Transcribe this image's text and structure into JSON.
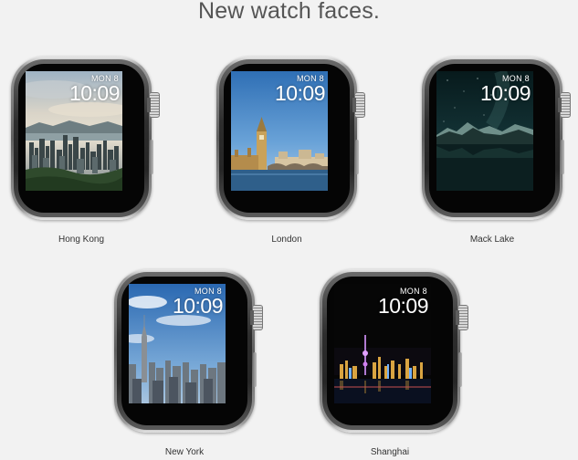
{
  "page": {
    "title": "New watch faces."
  },
  "watches": [
    {
      "name": "Hong Kong",
      "date": "MON 8",
      "time": "10:09"
    },
    {
      "name": "London",
      "date": "MON 8",
      "time": "10:09"
    },
    {
      "name": "Mack Lake",
      "date": "MON 8",
      "time": "10:09"
    },
    {
      "name": "New York",
      "date": "MON 8",
      "time": "10:09"
    },
    {
      "name": "Shanghai",
      "date": "MON 8",
      "time": "10:09"
    }
  ]
}
